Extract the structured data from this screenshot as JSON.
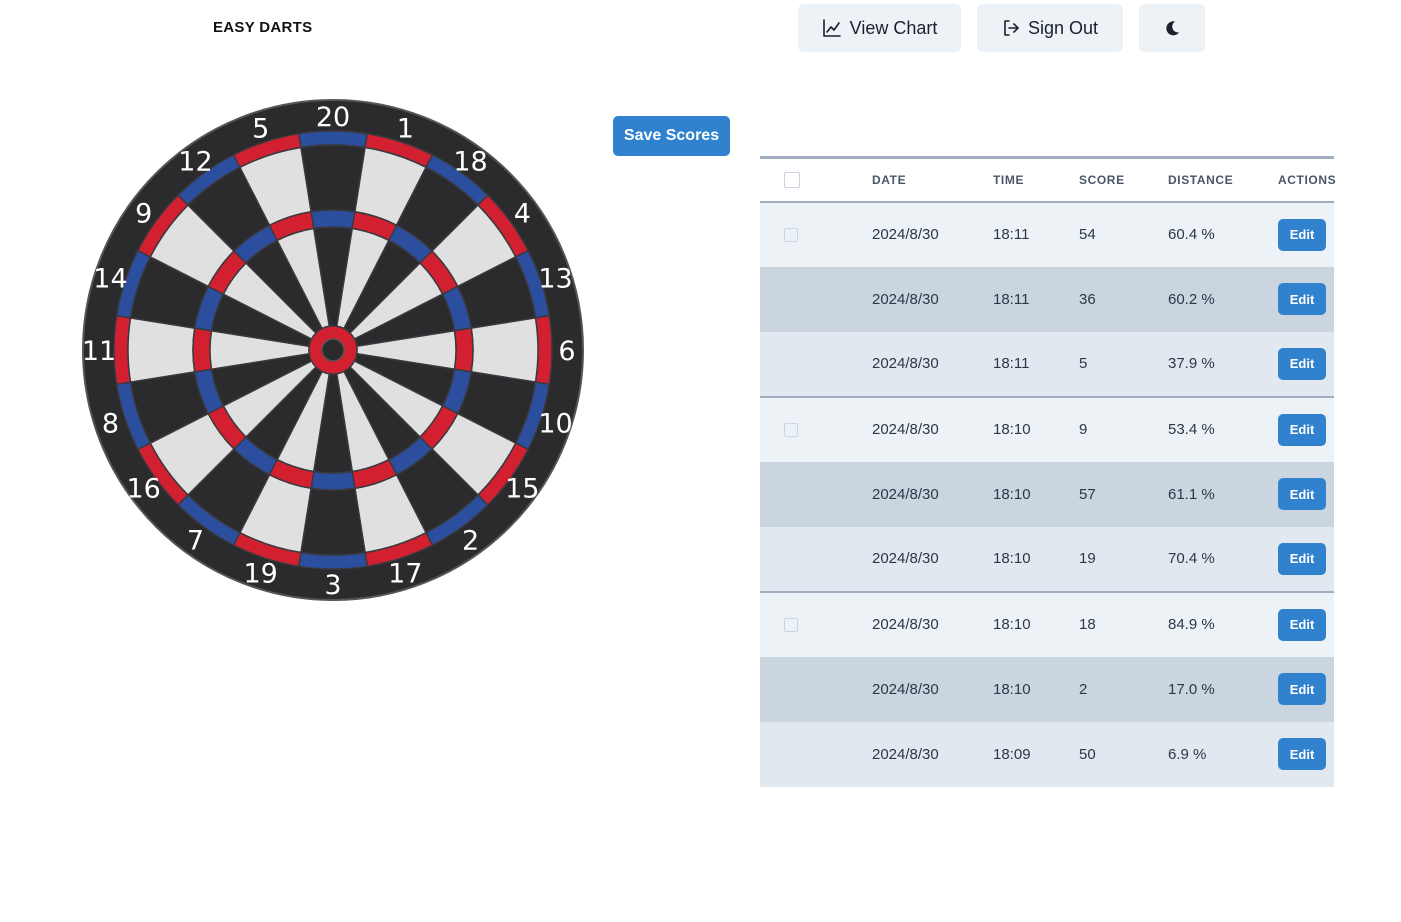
{
  "app": {
    "title": "EASY DARTS"
  },
  "toolbar": {
    "view_chart_label": "View Chart",
    "sign_out_label": "Sign Out",
    "theme_icon": "moon-icon"
  },
  "save_label": "Save Scores",
  "dartboard": {
    "numbers": [
      20,
      1,
      18,
      4,
      13,
      6,
      10,
      15,
      2,
      17,
      3,
      19,
      7,
      16,
      8,
      11,
      14,
      9,
      12,
      5
    ],
    "colors": {
      "dark": "#2b2b2e",
      "light": "#e0e0e0",
      "red": "#d32030",
      "blue": "#2b4e9e",
      "rim": "#2b2b2e"
    }
  },
  "table": {
    "headers": [
      "DATE",
      "TIME",
      "SCORE",
      "DISTANCE",
      "ACTIONS"
    ],
    "edit_label": "Edit",
    "rows": [
      {
        "date": "2024/8/30",
        "time": "18:11",
        "score": "54",
        "distance": "60.4 %",
        "checkbox": true
      },
      {
        "date": "2024/8/30",
        "time": "18:11",
        "score": "36",
        "distance": "60.2 %",
        "checkbox": true
      },
      {
        "date": "2024/8/30",
        "time": "18:11",
        "score": "5",
        "distance": "37.9 %",
        "checkbox": false
      },
      {
        "date": "2024/8/30",
        "time": "18:10",
        "score": "9",
        "distance": "53.4 %",
        "checkbox": true
      },
      {
        "date": "2024/8/30",
        "time": "18:10",
        "score": "57",
        "distance": "61.1 %",
        "checkbox": true
      },
      {
        "date": "2024/8/30",
        "time": "18:10",
        "score": "19",
        "distance": "70.4 %",
        "checkbox": false
      },
      {
        "date": "2024/8/30",
        "time": "18:10",
        "score": "18",
        "distance": "84.9 %",
        "checkbox": true
      },
      {
        "date": "2024/8/30",
        "time": "18:10",
        "score": "2",
        "distance": "17.0 %",
        "checkbox": true
      },
      {
        "date": "2024/8/30",
        "time": "18:09",
        "score": "50",
        "distance": "6.9 %",
        "checkbox": false
      }
    ]
  },
  "colors": {
    "accent": "#3182ce",
    "button_bg": "#edf2f7"
  }
}
